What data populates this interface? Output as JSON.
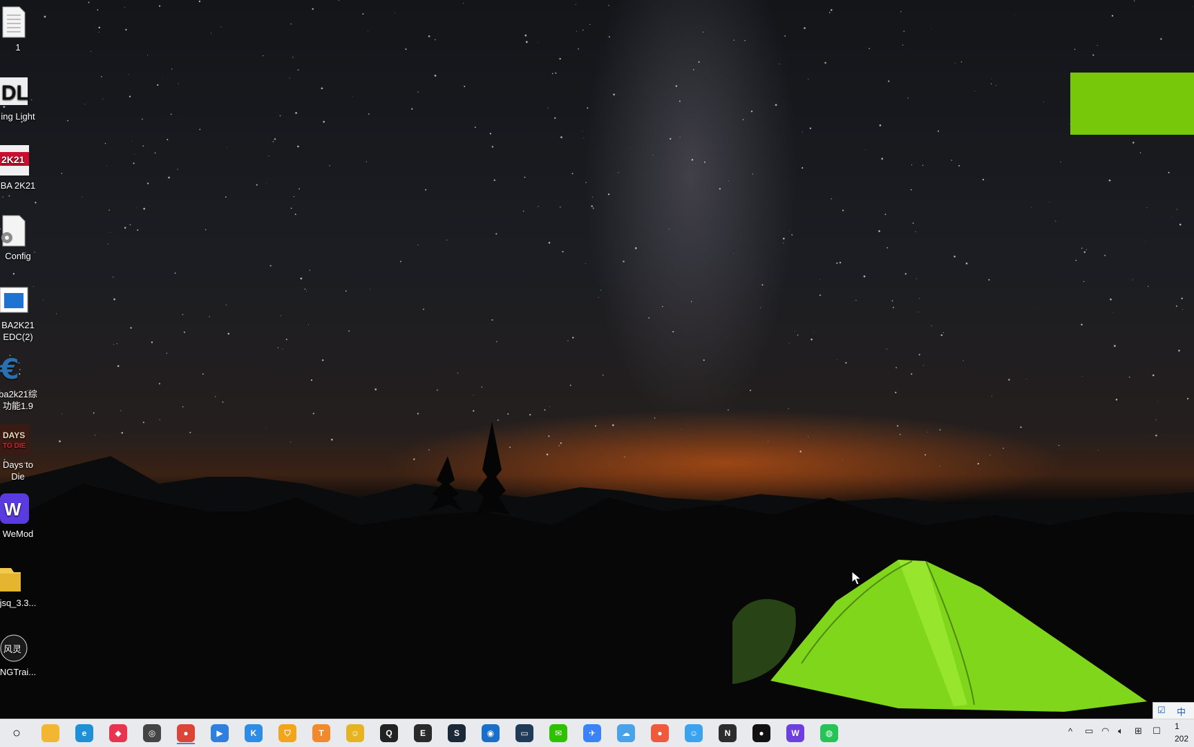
{
  "desktop": {
    "icons": [
      {
        "label": "1",
        "icon": "text-file-icon"
      },
      {
        "label": "ing Light",
        "icon": "dying-light-icon"
      },
      {
        "label": "BA 2K21",
        "icon": "nba2k21-icon"
      },
      {
        "label": "Config",
        "icon": "config-file-icon"
      },
      {
        "label": "BA2K21\nEDC(2)",
        "icon": "document-icon"
      },
      {
        "label": "ba2k21综\n功能1.9",
        "icon": "cheat-engine-icon"
      },
      {
        "label": "Days to\nDie",
        "icon": "7-days-to-die-icon"
      },
      {
        "label": "WeMod",
        "icon": "wemod-icon"
      },
      {
        "label": "jsq_3.3...",
        "icon": "folder-icon"
      },
      {
        "label": "NGTrai...",
        "icon": "flingtrainer-icon"
      }
    ]
  },
  "notification": {
    "color": "#77c80a"
  },
  "taskbar": {
    "apps": [
      {
        "name": "search",
        "icon": "search-circle-icon",
        "color": "#e8eaed",
        "glyph": "○"
      },
      {
        "name": "file-explorer",
        "icon": "folder-icon",
        "color": "#f2b632",
        "glyph": ""
      },
      {
        "name": "edge",
        "icon": "edge-icon",
        "color": "#1f8fd6",
        "glyph": "e"
      },
      {
        "name": "app-red",
        "icon": "diamond-icon",
        "color": "#e8344e",
        "glyph": "◆"
      },
      {
        "name": "app-gray",
        "icon": "gray-app-icon",
        "color": "#444",
        "glyph": "◎"
      },
      {
        "name": "chrome",
        "icon": "chrome-icon",
        "color": "#db4437",
        "glyph": "●"
      },
      {
        "name": "video",
        "icon": "video-icon",
        "color": "#2f7fe0",
        "glyph": "▶"
      },
      {
        "name": "k-app",
        "icon": "k-icon",
        "color": "#2d8ce6",
        "glyph": "K"
      },
      {
        "name": "shield-app",
        "icon": "shield-icon",
        "color": "#f2a51a",
        "glyph": "⛉"
      },
      {
        "name": "tdf-app",
        "icon": "tdf-icon",
        "color": "#f08a2c",
        "glyph": "T"
      },
      {
        "name": "char-app",
        "icon": "character-icon",
        "color": "#e6b422",
        "glyph": "☺"
      },
      {
        "name": "qq",
        "icon": "qq-penguin-icon",
        "color": "#222",
        "glyph": "Q"
      },
      {
        "name": "epic",
        "icon": "epic-games-icon",
        "color": "#2a2a2a",
        "glyph": "E"
      },
      {
        "name": "steam",
        "icon": "steam-icon",
        "color": "#1b2838",
        "glyph": "S"
      },
      {
        "name": "uplay",
        "icon": "ubisoft-icon",
        "color": "#1a6fc9",
        "glyph": "◉"
      },
      {
        "name": "terminal-app",
        "icon": "monitor-icon",
        "color": "#1f3b57",
        "glyph": "▭"
      },
      {
        "name": "wechat",
        "icon": "wechat-icon",
        "color": "#2dc100",
        "glyph": "✉"
      },
      {
        "name": "bird-app",
        "icon": "bird-icon",
        "color": "#3b82f6",
        "glyph": "✈"
      },
      {
        "name": "cloud-app",
        "icon": "cloud-icon",
        "color": "#4aa3e8",
        "glyph": "☁"
      },
      {
        "name": "map-app",
        "icon": "location-pin-icon",
        "color": "#ef5a3c",
        "glyph": "●"
      },
      {
        "name": "chat-app",
        "icon": "chat-bubble-icon",
        "color": "#3aa3f0",
        "glyph": "☺"
      },
      {
        "name": "nvidia",
        "icon": "nvidia-icon",
        "color": "#2c2c2c",
        "glyph": "N"
      },
      {
        "name": "dark-app",
        "icon": "round-dark-icon",
        "color": "#111",
        "glyph": "●"
      },
      {
        "name": "wemod",
        "icon": "wemod-icon",
        "color": "#6d3fe0",
        "glyph": "W"
      },
      {
        "name": "green-app",
        "icon": "green-globe-icon",
        "color": "#26c456",
        "glyph": "◍"
      }
    ],
    "tray": {
      "chevron": "^",
      "ime": "中",
      "clock_line1": "1",
      "clock_line2": "202"
    }
  }
}
